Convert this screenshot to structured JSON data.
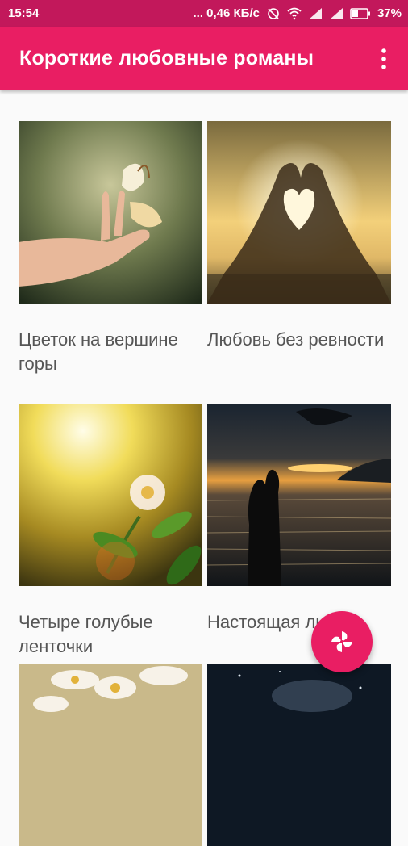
{
  "status_bar": {
    "time": "15:54",
    "network_speed": "... 0,46 КБ/с",
    "battery": "37%"
  },
  "app_bar": {
    "title": "Короткие любовные романы",
    "menu_icon": "more-vert-icon"
  },
  "stories": [
    {
      "title": "Цветок на вершине горы",
      "image": "hand-butterfly-image"
    },
    {
      "title": "Любовь без ревности",
      "image": "heart-hands-sunset-image"
    },
    {
      "title": "Четыре голубые ленточки",
      "image": "sunlit-flower-image"
    },
    {
      "title": "Настоящая любовь",
      "image": "couple-sea-sunset-image"
    },
    {
      "title": "",
      "image": "daisies-image"
    },
    {
      "title": "",
      "image": "dark-night-image"
    }
  ],
  "fab": {
    "icon": "pinwheel-icon"
  },
  "colors": {
    "primary": "#e91e63",
    "primary_dark": "#c2185b"
  }
}
